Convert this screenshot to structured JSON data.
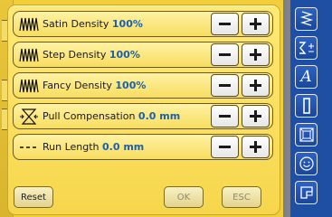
{
  "dialog": {
    "rows": [
      {
        "icon": "satin-stitch-icon",
        "label": "Satin Density",
        "value": "100%"
      },
      {
        "icon": "step-stitch-icon",
        "label": "Step Density",
        "value": "100%"
      },
      {
        "icon": "fancy-stitch-icon",
        "label": "Fancy Density",
        "value": "100%"
      },
      {
        "icon": "pull-compensation-icon",
        "label": "Pull Compensation",
        "value": "0.0 mm"
      },
      {
        "icon": "run-length-icon",
        "label": "Run Length",
        "value": "0.0 mm"
      }
    ],
    "buttons": {
      "reset": "Reset",
      "ok": "OK",
      "esc": "ESC"
    }
  },
  "sidebar": {
    "items": [
      {
        "icon": "zigzag-stitch-icon"
      },
      {
        "icon": "stitch-select-icon"
      },
      {
        "icon": "alphabet-icon",
        "glyph": "A"
      },
      {
        "icon": "buttonhole-icon"
      },
      {
        "icon": "quilt-frame-icon"
      },
      {
        "icon": "face-icon"
      },
      {
        "icon": "settings-icon"
      }
    ]
  },
  "colors": {
    "background": "#f2cf3a",
    "value_blue": "#1a5fb0",
    "sidebar_blue": "#1f4fa3"
  }
}
